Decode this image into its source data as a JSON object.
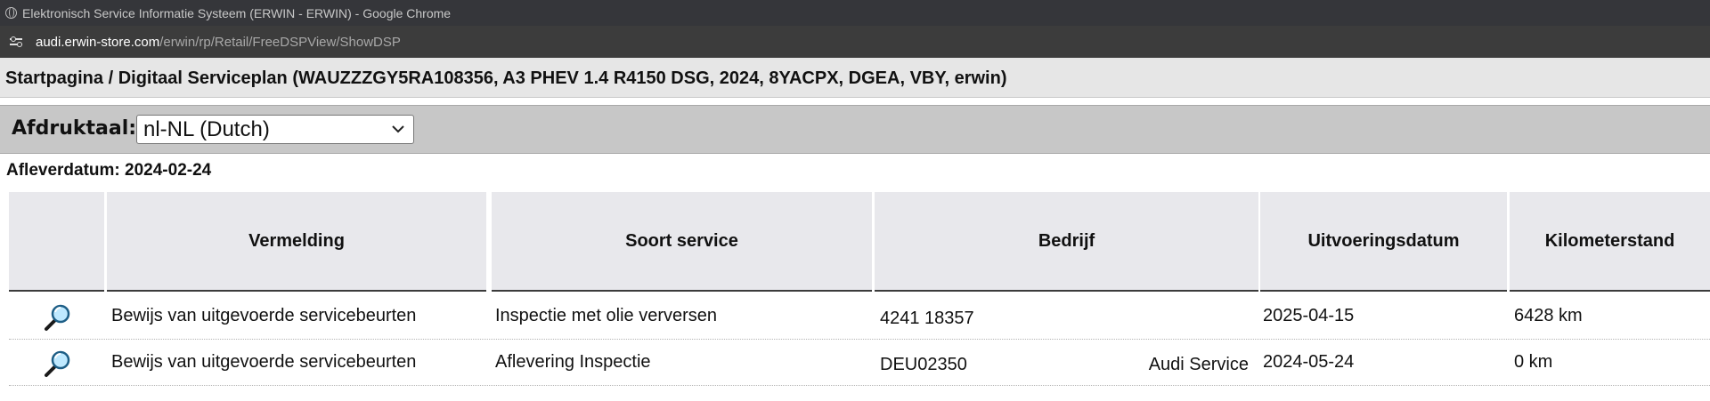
{
  "window": {
    "title": "Elektronisch Service Informatie Systeem (ERWIN - ERWIN) - Google Chrome"
  },
  "address": {
    "host": "audi.erwin-store.com",
    "path": "/erwin/rp/Retail/FreeDSPView/ShowDSP"
  },
  "header": {
    "breadcrumb": "Startpagina / Digitaal Serviceplan (WAUZZZGY5RA108356, A3 PHEV 1.4 R4150 DSG, 2024, 8YACPX, DGEA, VBY, erwin)"
  },
  "language": {
    "label": "Afdruktaal:",
    "selected": "nl-NL (Dutch)"
  },
  "delivery": {
    "text": "Afleverdatum: 2024-02-24"
  },
  "table": {
    "columns": [
      "",
      "Vermelding",
      "Soort service",
      "Bedrijf",
      "Uitvoeringsdatum",
      "Kilometerstand"
    ],
    "rows": [
      {
        "icon": "magnifier-icon",
        "vermelding": "Bewijs van uitgevoerde servicebeurten",
        "soort": "Inspectie met olie verversen",
        "bedrijf_code": "4241 18357",
        "bedrijf_name": "",
        "datum": "2025-04-15",
        "km": "6428 km"
      },
      {
        "icon": "magnifier-icon",
        "vermelding": "Bewijs van uitgevoerde servicebeurten",
        "soort": "Aflevering Inspectie",
        "bedrijf_code": "DEU02350",
        "bedrijf_name": "Audi Service",
        "datum": "2024-05-24",
        "km": "0 km"
      }
    ]
  }
}
